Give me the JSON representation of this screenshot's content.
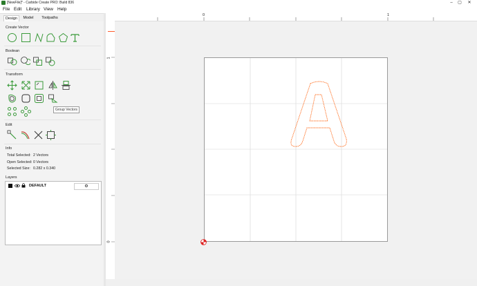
{
  "window": {
    "title": "[NewFile]* - Carbide Create PRO: Build 836",
    "min": "–",
    "max": "▢",
    "close": "✕"
  },
  "menu": [
    "File",
    "Edit",
    "Library",
    "View",
    "Help"
  ],
  "tabs": [
    "Design",
    "Model",
    "Toolpaths"
  ],
  "active_tab": "Design",
  "sections": {
    "create_vector": "Create Vector",
    "boolean": "Boolean",
    "transform": "Transform",
    "edit": "Edit",
    "info": "Info",
    "layers": "Layers"
  },
  "create_vector_tools": [
    "circle-icon",
    "rectangle-icon",
    "curve-icon",
    "polygon-icon",
    "pentagon-icon",
    "text-icon"
  ],
  "boolean_tools": [
    "union-icon",
    "subtract-icon",
    "intersect-icon",
    "weld-icon"
  ],
  "transform_tools": [
    "move-icon",
    "scale-icon",
    "rotate-icon",
    "mirror-icon",
    "align-icon",
    "offset-icon",
    "fillet-icon",
    "join-icon",
    "node-edit-icon",
    "group-icon",
    "ungroup-icon"
  ],
  "edit_tools": [
    "node-edit-icon",
    "trim-icon",
    "cut-icon",
    "bounding-box-icon"
  ],
  "tooltip": "Group Vectors",
  "info": [
    {
      "label": "Total Selected:",
      "value": "2 Vectors"
    },
    {
      "label": "Open Selected:",
      "value": "0 Vectors"
    },
    {
      "label": "Selected Size:",
      "value": "0.282 x 0.340"
    }
  ],
  "layers": [
    {
      "name": "DEFAULT",
      "color": "#000000",
      "visible": true,
      "locked": true
    }
  ],
  "ruler": {
    "x0": "0",
    "x1": "1",
    "y0": "0",
    "y1": "1"
  },
  "colors": {
    "accent": "#3a9a3a",
    "selection": "#ff6600",
    "grid": "#cfcfcf"
  }
}
